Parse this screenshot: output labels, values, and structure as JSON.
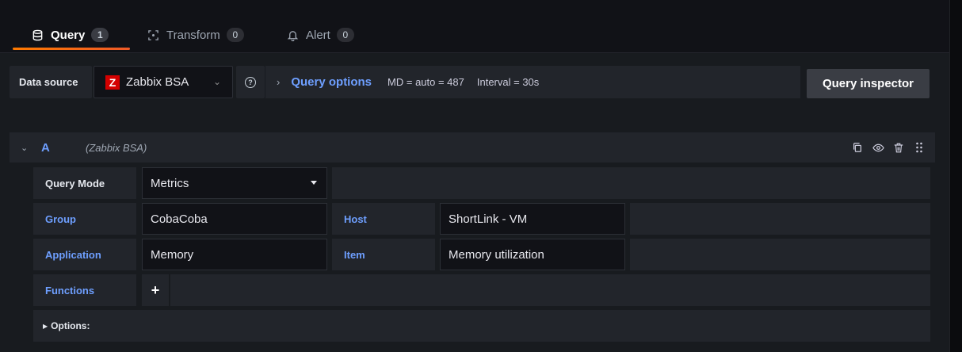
{
  "tabs": [
    {
      "label": "Query",
      "count": "1",
      "icon": "database-icon"
    },
    {
      "label": "Transform",
      "count": "0",
      "icon": "transform-icon"
    },
    {
      "label": "Alert",
      "count": "0",
      "icon": "bell-icon"
    }
  ],
  "toolbar": {
    "datasource_label": "Data source",
    "datasource_logo": "Z",
    "datasource_name": "Zabbix BSA",
    "query_options_label": "Query options",
    "md": "MD = auto = 487",
    "interval": "Interval = 30s",
    "inspector_label": "Query inspector"
  },
  "query": {
    "ref_id": "A",
    "datasource": "(Zabbix BSA)"
  },
  "editor": {
    "query_mode_label": "Query Mode",
    "query_mode_value": "Metrics",
    "group_label": "Group",
    "group_value": "CobaCoba",
    "host_label": "Host",
    "host_value": "ShortLink - VM",
    "application_label": "Application",
    "application_value": "Memory",
    "item_label": "Item",
    "item_value": "Memory utilization",
    "functions_label": "Functions",
    "add_function": "+",
    "options_label": "Options:"
  },
  "colors": {
    "accent_blue": "#6e9fff",
    "tab_underline": "#f05a28",
    "zabbix_red": "#d40000"
  }
}
